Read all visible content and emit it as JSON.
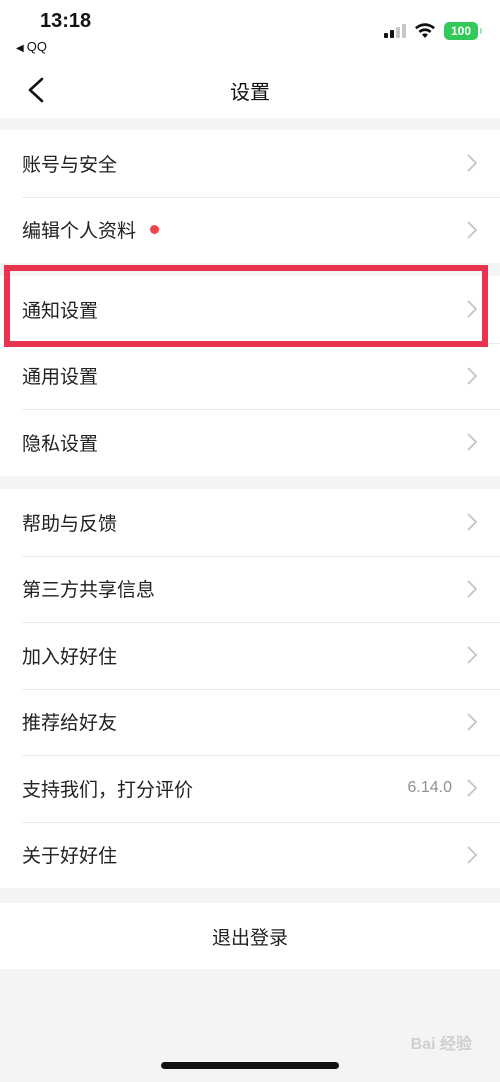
{
  "status_bar": {
    "time": "13:18",
    "back_app": "QQ",
    "battery": "100",
    "icons": [
      "signal-icon",
      "wifi-icon",
      "battery-icon"
    ],
    "battery_color": "#34c759"
  },
  "nav": {
    "title": "设置",
    "back_icon": "chevron-left-icon"
  },
  "groups": [
    {
      "items": [
        {
          "label": "账号与安全"
        },
        {
          "label": "编辑个人资料",
          "badge": "red-dot"
        }
      ]
    },
    {
      "items": [
        {
          "label": "通知设置",
          "highlighted": true
        },
        {
          "label": "通用设置"
        },
        {
          "label": "隐私设置"
        }
      ]
    },
    {
      "items": [
        {
          "label": "帮助与反馈"
        },
        {
          "label": "第三方共享信息"
        },
        {
          "label": "加入好好住"
        },
        {
          "label": "推荐给好友"
        },
        {
          "label": "支持我们，打分评价",
          "value": "6.14.0"
        },
        {
          "label": "关于好好住"
        }
      ]
    }
  ],
  "logout": {
    "label": "退出登录"
  },
  "watermark": "Bai 经验",
  "colors": {
    "highlight_border": "#e8344e",
    "badge_dot": "#f0424f",
    "background": "#f4f4f4"
  }
}
